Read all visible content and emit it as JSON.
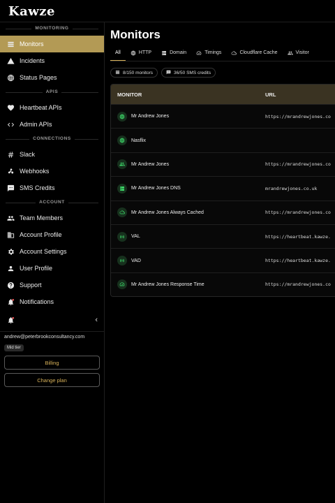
{
  "app": {
    "title": "Kawze"
  },
  "sidebar": {
    "sections": [
      {
        "label": "MONITORING",
        "items": [
          {
            "label": "Monitors",
            "icon": "monitor-icon",
            "active": true
          },
          {
            "label": "Incidents",
            "icon": "warning-icon"
          },
          {
            "label": "Status Pages",
            "icon": "globe-icon"
          }
        ]
      },
      {
        "label": "APIS",
        "items": [
          {
            "label": "Heartbeat APIs",
            "icon": "heart-icon"
          },
          {
            "label": "Admin APIs",
            "icon": "code-icon"
          }
        ]
      },
      {
        "label": "CONNECTIONS",
        "items": [
          {
            "label": "Slack",
            "icon": "hash-icon"
          },
          {
            "label": "Webhooks",
            "icon": "webhook-icon"
          },
          {
            "label": "SMS Credits",
            "icon": "sms-icon"
          }
        ]
      },
      {
        "label": "ACCOUNT",
        "items": [
          {
            "label": "Team Members",
            "icon": "team-icon"
          },
          {
            "label": "Account Profile",
            "icon": "building-icon"
          },
          {
            "label": "Account Settings",
            "icon": "gear-icon"
          },
          {
            "label": "User Profile",
            "icon": "user-icon"
          },
          {
            "label": "Support",
            "icon": "help-icon"
          },
          {
            "label": "Notifications",
            "icon": "bell-icon"
          }
        ]
      }
    ],
    "collapse_glyph": "‹",
    "email": "andrew@peterbrookconsultancy.com",
    "tier": "Mid tier",
    "billing_label": "Billing",
    "change_plan_label": "Change plan"
  },
  "main": {
    "title": "Monitors",
    "tabs": [
      {
        "label": "All",
        "icon": "",
        "active": true
      },
      {
        "label": "HTTP",
        "icon": "globe-icon"
      },
      {
        "label": "Domain",
        "icon": "dns-icon"
      },
      {
        "label": "Timings",
        "icon": "speed-icon"
      },
      {
        "label": "Cloudflare Cache",
        "icon": "cloud-icon"
      },
      {
        "label": "Visitor",
        "icon": "team-icon"
      }
    ],
    "chips": [
      {
        "label": "8/150 monitors",
        "icon": "monitor-icon"
      },
      {
        "label": "36/50 SMS credits",
        "icon": "sms-icon"
      }
    ],
    "table": {
      "headers": {
        "monitor": "MONITOR",
        "url": "URL"
      },
      "rows": [
        {
          "name": "Mr Andrew Jones",
          "url": "https://mrandrewjones.co",
          "icon": "globe-icon"
        },
        {
          "name": "Nasflix",
          "url": "",
          "icon": "globe-icon"
        },
        {
          "name": "Mr Andrew Jones",
          "url": "https://mrandrewjones.co",
          "icon": "team-icon"
        },
        {
          "name": "Mr Andrew Jones DNS",
          "url": "mrandrewjones.co.uk",
          "icon": "dns-icon"
        },
        {
          "name": "Mr Andrew Jones Always Cached",
          "url": "https://mrandrewjones.co",
          "icon": "cloud-icon"
        },
        {
          "name": "VAL",
          "url": "https://heartbeat.kawze.",
          "icon": "heartbeat-icon"
        },
        {
          "name": "VAD",
          "url": "https://heartbeat.kawze.",
          "icon": "heartbeat-icon"
        },
        {
          "name": "Mr Andrew Jones Response Time",
          "url": "https://mrandrewjones.co",
          "icon": "speed-icon"
        }
      ]
    }
  },
  "colors": {
    "accent": "#b39a55",
    "accent_text": "#d8b25a",
    "table_header": "#3a3322",
    "status_green": "#3ddb6a",
    "background": "#000000"
  }
}
